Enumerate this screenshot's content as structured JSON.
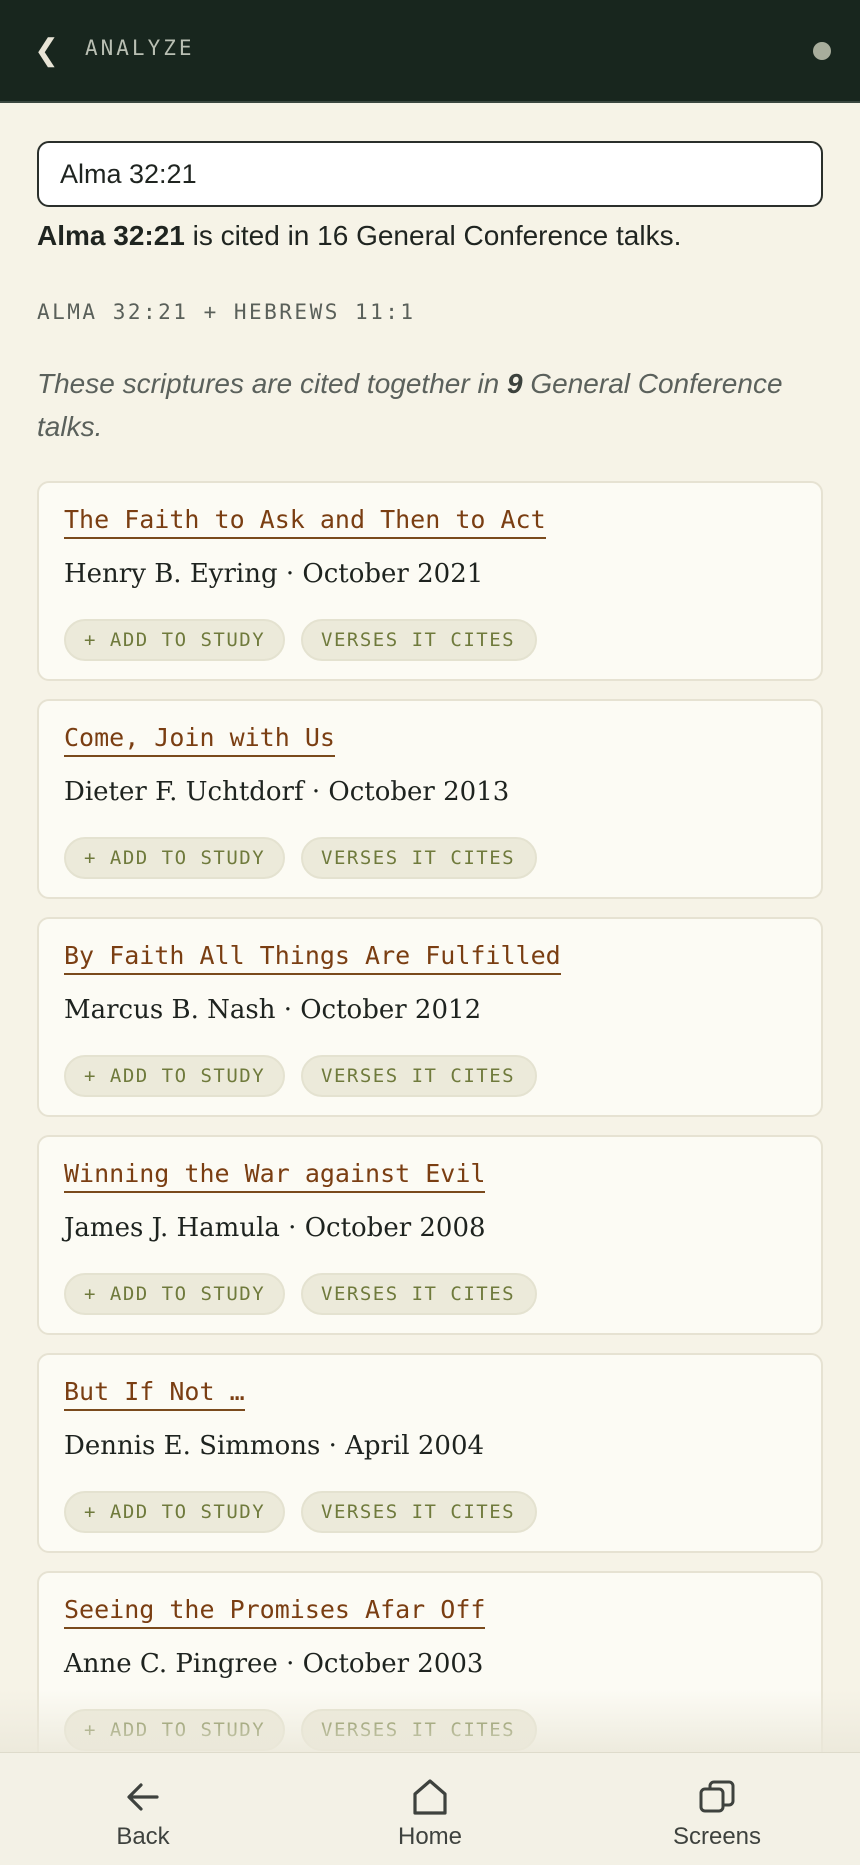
{
  "header": {
    "title": "ANALYZE"
  },
  "search": {
    "value": "Alma 32:21"
  },
  "summary": {
    "reference": "Alma 32:21",
    "text": " is cited in 16 General Conference talks."
  },
  "pair": {
    "label": "ALMA 32:21 + HEBREWS 11:1"
  },
  "together": {
    "prefix": "These scriptures are cited together in ",
    "count": "9",
    "suffix": " General Conference talks."
  },
  "buttons": {
    "add": "+ ADD TO STUDY",
    "verses": "VERSES IT CITES"
  },
  "talks": [
    {
      "title": "The Faith to Ask and Then to Act",
      "meta": "Henry B. Eyring · October 2021"
    },
    {
      "title": "Come, Join with Us",
      "meta": "Dieter F. Uchtdorf · October 2013"
    },
    {
      "title": "By Faith All Things Are Fulfilled",
      "meta": "Marcus B. Nash · October 2012"
    },
    {
      "title": "Winning the War against Evil",
      "meta": "James J. Hamula · October 2008"
    },
    {
      "title": "But If Not …",
      "meta": "Dennis E. Simmons · April 2004"
    },
    {
      "title": "Seeing the Promises Afar Off",
      "meta": "Anne C. Pingree · October 2003"
    }
  ],
  "nav": {
    "back": {
      "label": "Back",
      "icon": "arrow-left-icon"
    },
    "home": {
      "label": "Home",
      "icon": "home-icon"
    },
    "screens": {
      "label": "Screens",
      "icon": "screens-icon"
    }
  },
  "colors": {
    "header_bg": "#18261e",
    "page_bg": "#f6f3e7",
    "title_link": "#7a3e12",
    "button_text": "#6f7a3c"
  }
}
